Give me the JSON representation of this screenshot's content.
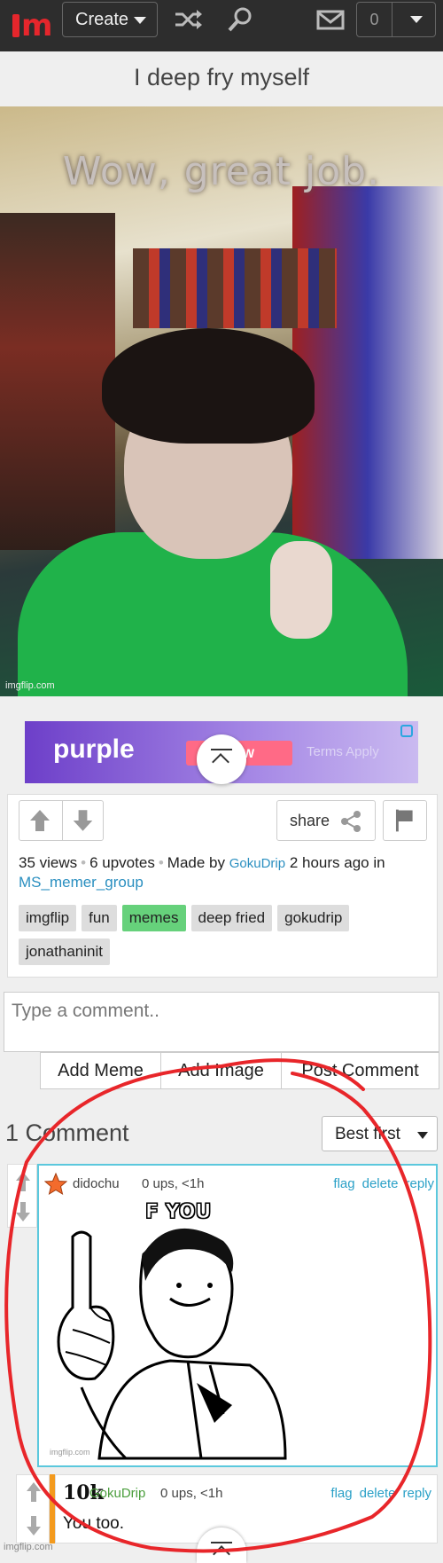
{
  "topbar": {
    "create_label": "Create",
    "notif_count": "0",
    "icons": [
      "shuffle-icon",
      "search-icon",
      "mail-icon",
      "chevron-down-icon"
    ]
  },
  "post": {
    "title": "I deep fry myself",
    "meme_caption": "Wow, great job.",
    "meme_watermark": "imgflip.com"
  },
  "ad": {
    "brand": "purple",
    "cta": "NOW",
    "terms": "Terms Apply"
  },
  "info": {
    "share_label": "share",
    "views": "35 views",
    "upvotes": "6 upvotes",
    "made_by_prefix": "Made by",
    "author": "GokuDrip",
    "time_in": "2 hours ago in",
    "stream": "MS_memer_group",
    "tags": [
      {
        "label": "imgflip",
        "highlight": false
      },
      {
        "label": "fun",
        "highlight": false
      },
      {
        "label": "memes",
        "highlight": true
      },
      {
        "label": "deep fried",
        "highlight": false
      },
      {
        "label": "gokudrip",
        "highlight": false
      },
      {
        "label": "jonathaninit",
        "highlight": false
      }
    ]
  },
  "comment_form": {
    "placeholder": "Type a comment..",
    "add_meme": "Add Meme",
    "add_image": "Add Image",
    "post_comment": "Post Comment"
  },
  "comments": {
    "count_label": "1 Comment",
    "sort_label": "Best first",
    "items": [
      {
        "user": "didochu",
        "meta": "0 ups, <1h",
        "actions": [
          "flag",
          "delete",
          "reply"
        ],
        "meme_caption": "F YOU",
        "meme_watermark": "imgflip.com"
      },
      {
        "score": "10k",
        "user": "GokuDrip",
        "meta": "0 ups, <1h",
        "actions": [
          "flag",
          "delete",
          "reply"
        ],
        "text": "You too."
      }
    ]
  },
  "page_watermark": "imgflip.com",
  "colors": {
    "brand_red": "#e5262c",
    "topbar_bg": "#2d2d2d",
    "link_blue": "#2a8fc0",
    "tag_highlight": "#66d17b",
    "comment_border": "#5bc8dd",
    "reply_bar": "#f39a1e",
    "annotation_red": "#e8262a"
  }
}
